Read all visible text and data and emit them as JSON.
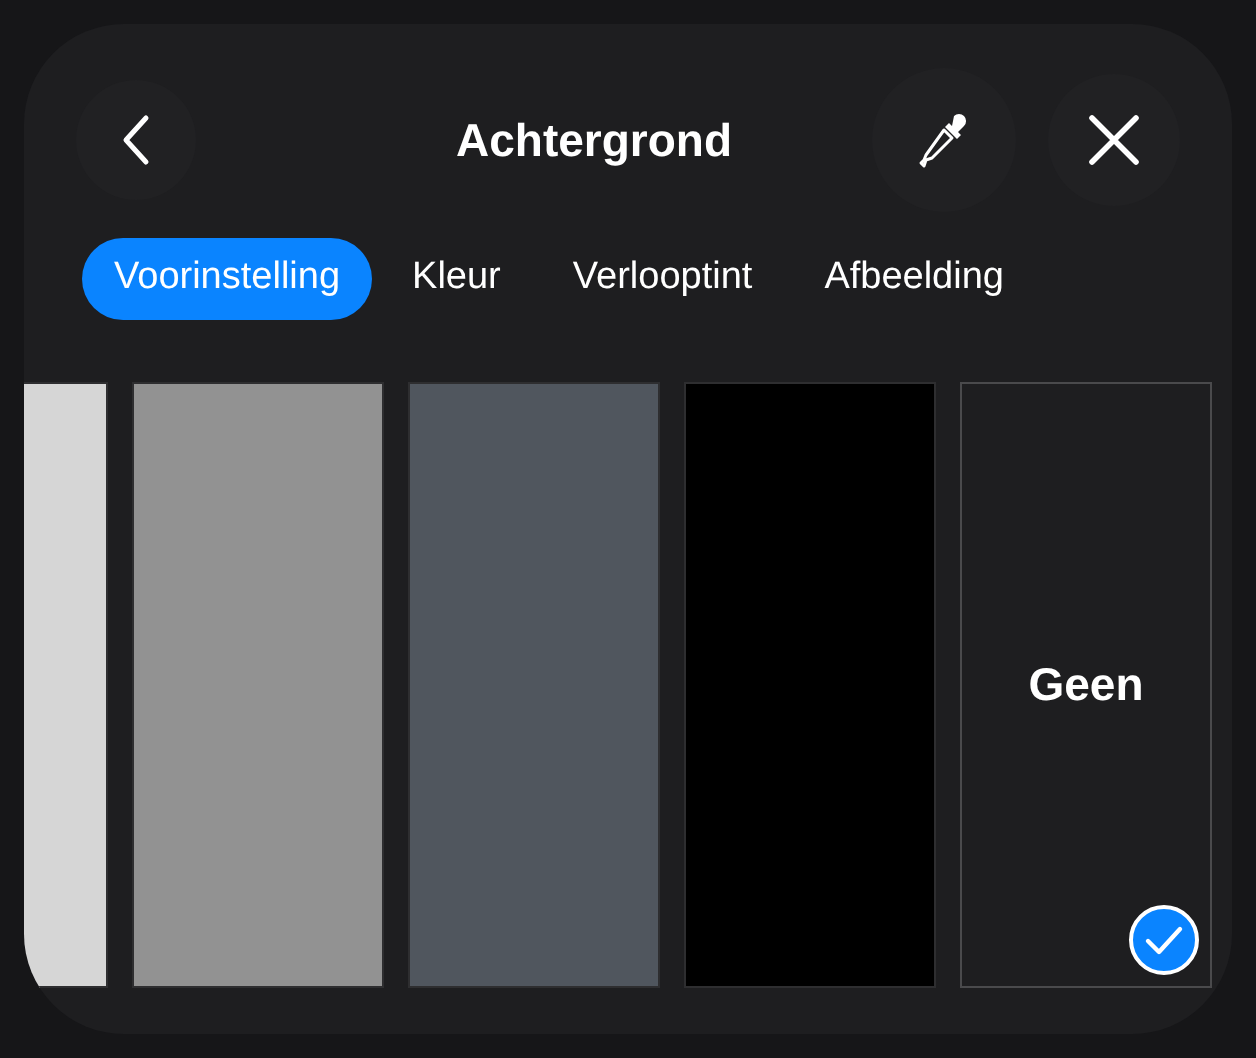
{
  "header": {
    "title": "Achtergrond"
  },
  "tabs": [
    {
      "label": "Voorinstelling",
      "selected": true
    },
    {
      "label": "Kleur",
      "selected": false
    },
    {
      "label": "Verlooptint",
      "selected": false
    },
    {
      "label": "Afbeelding",
      "selected": false
    }
  ],
  "swatches": [
    {
      "kind": "color",
      "color": "#d6d6d6",
      "selected": false
    },
    {
      "kind": "color",
      "color": "#929292",
      "selected": false
    },
    {
      "kind": "color",
      "color": "#50565e",
      "selected": false
    },
    {
      "kind": "color",
      "color": "#000000",
      "selected": false
    },
    {
      "kind": "none",
      "label": "Geen",
      "selected": true
    }
  ]
}
